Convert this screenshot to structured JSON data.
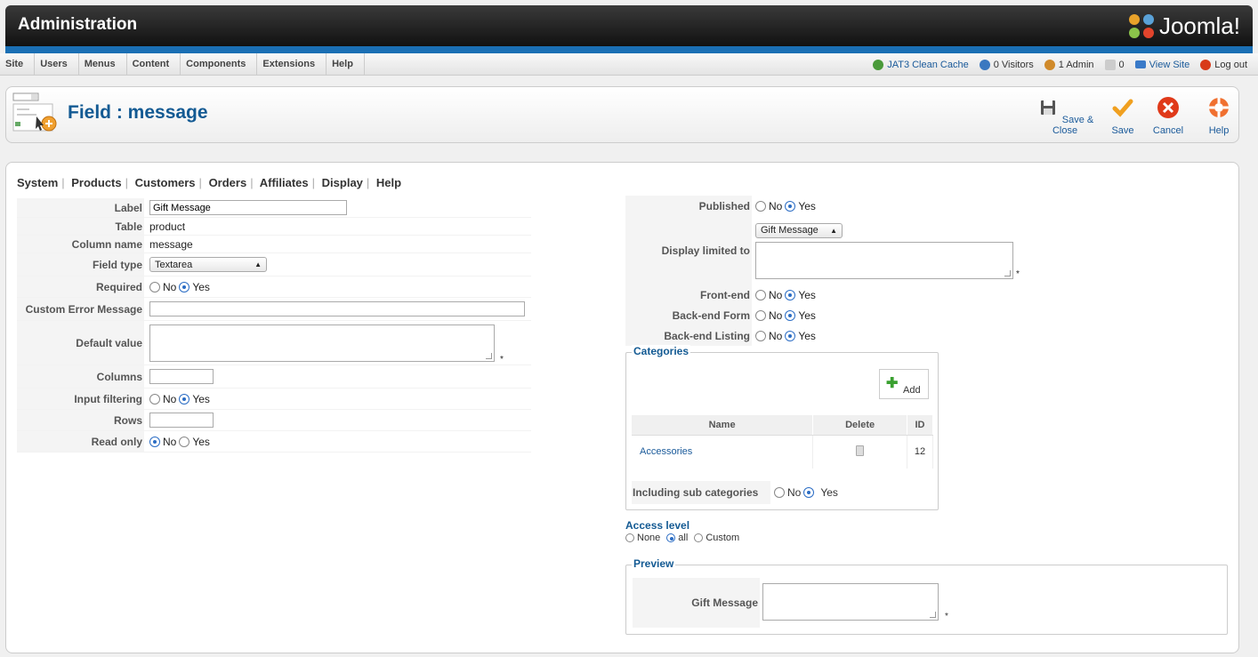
{
  "header": {
    "title": "Administration",
    "brand": "Joomla!"
  },
  "menu": [
    "Site",
    "Users",
    "Menus",
    "Content",
    "Components",
    "Extensions",
    "Help"
  ],
  "status": {
    "cache": "JAT3 Clean Cache",
    "visitors": "0 Visitors",
    "admins": "1 Admin",
    "messages": "0",
    "view_site": "View Site",
    "logout": "Log out"
  },
  "toolbar": {
    "page_title": "Field : message",
    "save_close": "Save & Close",
    "save": "Save",
    "cancel": "Cancel",
    "help": "Help"
  },
  "subnav": [
    "System",
    "Products",
    "Customers",
    "Orders",
    "Affiliates",
    "Display",
    "Help"
  ],
  "left_form": {
    "label_label": "Label",
    "label_value": "Gift Message",
    "table_label": "Table",
    "table_value": "product",
    "column_label": "Column name",
    "column_value": "message",
    "fieldtype_label": "Field type",
    "fieldtype_value": "Textarea",
    "required_label": "Required",
    "error_label": "Custom Error Message",
    "default_label": "Default value",
    "columns_label": "Columns",
    "filter_label": "Input filtering",
    "rows_label": "Rows",
    "readonly_label": "Read only",
    "no": "No",
    "yes": "Yes",
    "star": "*"
  },
  "right_form": {
    "published_label": "Published",
    "display_label": "Display limited to",
    "display_select": "Gift Message",
    "frontend_label": "Front-end",
    "backend_form_label": "Back-end Form",
    "backend_listing_label": "Back-end Listing",
    "categories_legend": "Categories",
    "add_label": "Add",
    "col_name": "Name",
    "col_delete": "Delete",
    "col_id": "ID",
    "cat_name": "Accessories",
    "cat_id": "12",
    "subcat_label": "Including sub categories",
    "access_legend": "Access level",
    "access_none": "None",
    "access_all": "all",
    "access_custom": "Custom",
    "preview_legend": "Preview",
    "preview_label": "Gift Message"
  }
}
